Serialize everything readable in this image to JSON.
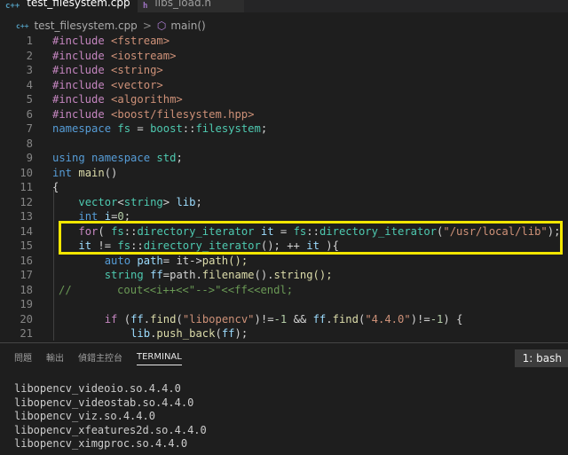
{
  "tabs": [
    {
      "icon": "c++",
      "label": "test_filesystem.cpp",
      "close": "×"
    },
    {
      "icon": "h",
      "label": "libs_load.h"
    }
  ],
  "breadcrumb": {
    "file_icon": "c++",
    "file": "test_filesystem.cpp",
    "separator": ">",
    "symbol": "main()"
  },
  "editor": {
    "lines": [
      {
        "n": "1"
      },
      {
        "n": "2"
      },
      {
        "n": "3"
      },
      {
        "n": "4"
      },
      {
        "n": "5"
      },
      {
        "n": "6"
      },
      {
        "n": "7"
      },
      {
        "n": "8"
      },
      {
        "n": "9"
      },
      {
        "n": "10"
      },
      {
        "n": "11"
      },
      {
        "n": "12"
      },
      {
        "n": "13"
      },
      {
        "n": "14"
      },
      {
        "n": "15"
      },
      {
        "n": "16"
      },
      {
        "n": "17"
      },
      {
        "n": "18"
      },
      {
        "n": "19"
      },
      {
        "n": "20"
      },
      {
        "n": "21"
      }
    ],
    "t": {
      "inc": "#include",
      "h1": "<fstream>",
      "h2": "<iostream>",
      "h3": "<string>",
      "h4": "<vector>",
      "h5": "<algorithm>",
      "h6": "<boost/filesystem.hpp>",
      "namespace": "namespace",
      "fs": "fs",
      "eq": " = ",
      "boost": "boost",
      "sc": "::",
      "filesystem": "filesystem",
      "semi": ";",
      "using": "using",
      "std": "std",
      "int": "int",
      "main": "main",
      "parens": "()",
      "lbrace": "{",
      "vector": "vector",
      "lt": "<",
      "string": "string",
      "gt": ">",
      "lib": "lib",
      "i": "i",
      "eq0": "=",
      "zero": "0",
      "for": "for",
      "lparen": "( ",
      "diter": "directory_iterator",
      "it": "it",
      "path_str": "\"/usr/local/lib\"",
      "rparen_semi": ");",
      "neq": " != ",
      "inc_it": "(); ++ ",
      "close_loop": " ){",
      "auto": "auto",
      "pathv": "path",
      "eq_it": "= it->",
      "path_call": "path();",
      "ff": "ff",
      "eq_path": "=path.",
      "filename": "filename",
      "dot": "().",
      "str_call": "string();",
      "comment": "//       cout<<i++<<\"-->\"<<ff<<endl;",
      "if": "if",
      "find": "find",
      "libopencv": "\"libopencv\"",
      "neg1": "-1",
      "and": " && ",
      "ver": "\"4.4.0\"",
      "neg1b": "-1",
      "push_back": "push_back"
    }
  },
  "panel": {
    "tabs": [
      "問題",
      "輸出",
      "偵錯主控台",
      "TERMINAL"
    ],
    "active_tab": "TERMINAL",
    "terminal_select": "1: bash",
    "terminal_lines": [
      "libopencv_videoio.so.4.4.0",
      "libopencv_videostab.so.4.4.0",
      "libopencv_viz.so.4.4.0",
      "libopencv_xfeatures2d.so.4.4.0",
      "libopencv_ximgproc.so.4.4.0"
    ]
  },
  "colors": {
    "highlight": "#f2e600",
    "keyword": "#569cd6",
    "string": "#ce9178",
    "type": "#4ec9b0"
  }
}
